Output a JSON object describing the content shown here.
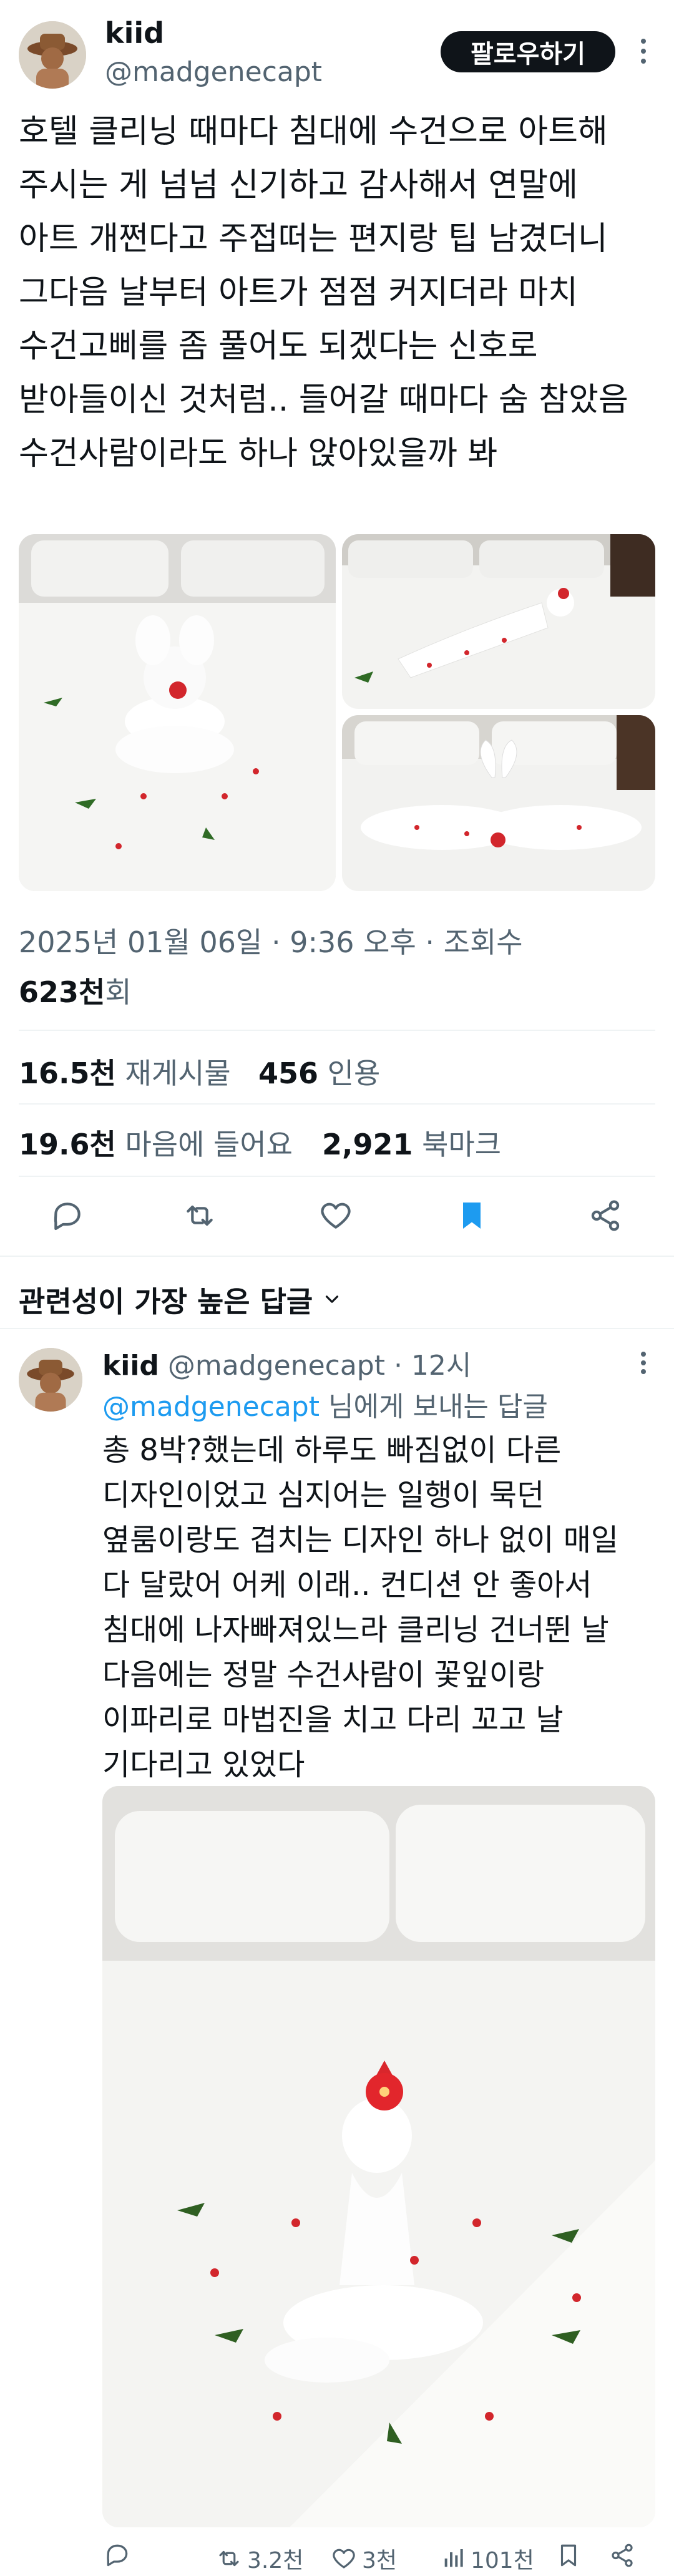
{
  "post": {
    "author": {
      "name": "kiid",
      "handle": "@madgenecapt"
    },
    "follow_label": "팔로우하기",
    "text_lines": [
      "호텔 클리닝 때마다 침대에 수건으로 아트해",
      "주시는 게 넘넘 신기하고 감사해서 연말에",
      "아트 개쩐다고 주접떠는 편지랑 팁 남겼더니",
      "그다음 날부터 아트가 점점 커지더라 마치",
      "수건고삐를 좀 풀어도 되겠다는 신호로",
      "받아들이신 것처럼.. 들어갈 때마다 숨 참았음",
      "수건사람이라도 하나 앉아있을까 봐"
    ],
    "timestamp_line": "2025년 01월 06일 · 9:36 오후 · 조회수",
    "views_value": "623천",
    "views_unit": "회",
    "reposts_value": "16.5천",
    "reposts_label": "재게시물",
    "quotes_value": "456",
    "quotes_label": "인용",
    "likes_value": "19.6천",
    "likes_label": "마음에 들어요",
    "bookmarks_value": "2,921",
    "bookmarks_label": "북마크"
  },
  "icons": {
    "reply": "reply-icon",
    "repost": "repost-icon",
    "like": "heart-icon",
    "bookmark": "bookmark-icon",
    "share": "share-icon",
    "views": "views-icon"
  },
  "colors": {
    "accent": "#1d9bf0",
    "text": "#0f1419",
    "muted": "#536471",
    "divider": "#eff3f4"
  },
  "replies_sort": "관련성이 가장 높은 답글",
  "reply": {
    "author": {
      "name": "kiid",
      "handle": "@madgenecapt"
    },
    "time": "· 12시",
    "replying_to_mention": "@madgenecapt",
    "replying_to_suffix": " 님에게 보내는 답글",
    "text_lines": [
      "총 8박?했는데 하루도 빠짐없이 다른",
      "디자인이었고 심지어는 일행이 묵던",
      "옆룸이랑도 겹치는 디자인 하나 없이 매일",
      "다 달랐어 어케 이래.. 컨디션 안 좋아서",
      "침대에 나자빠져있느라 클리닝 건너뛴 날",
      "다음에는 정말 수건사람이 꽃잎이랑",
      "이파리로 마법진을 치고 다리 꼬고 날",
      "기다리고 있었다"
    ],
    "reposts": "3.2천",
    "likes": "3천",
    "views": "101천"
  }
}
